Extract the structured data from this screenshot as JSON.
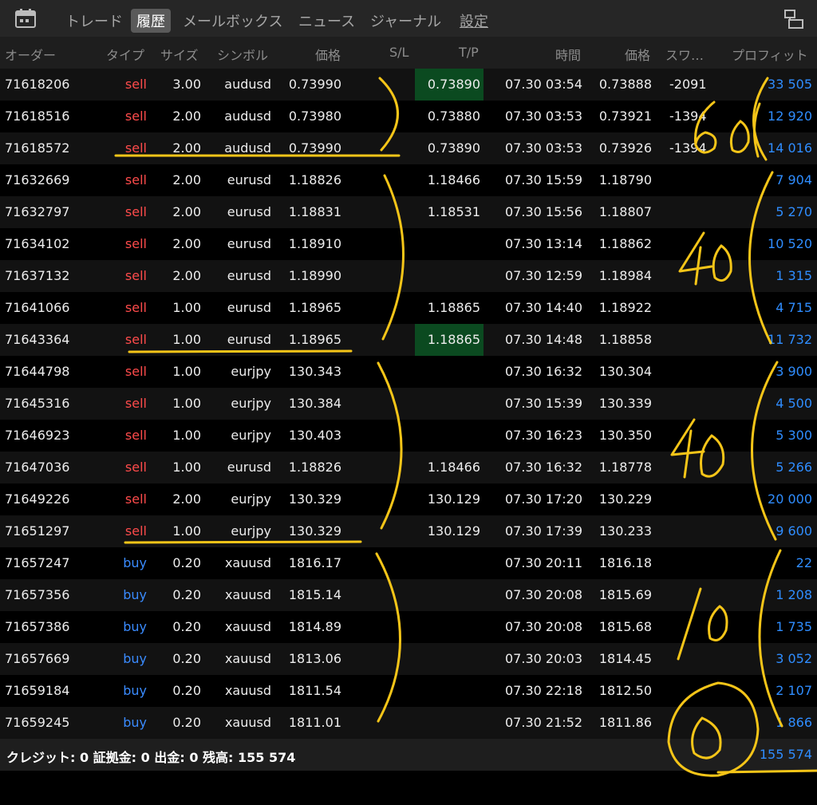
{
  "toolbar": {
    "app_icon": "calendar-icon",
    "tabs": [
      "トレード",
      "履歴",
      "メールボックス",
      "ニュース",
      "ジャーナル",
      "設定"
    ],
    "active_tab": "履歴",
    "right_icon": "split-view-icon"
  },
  "columns": [
    "オーダー",
    "タイプ",
    "サイズ",
    "シンボル",
    "価格",
    "S/L",
    "T/P",
    "時間",
    "価格",
    "スワ…",
    "プロフィット"
  ],
  "rows": [
    {
      "order": "71618206",
      "type": "sell",
      "size": "3.00",
      "symbol": "audusd",
      "price": "0.73990",
      "sl": "",
      "tp": "0.73890",
      "tp_hl": true,
      "time": "07.30 03:54",
      "close": "0.73888",
      "swap": "-2091",
      "profit": "33 505"
    },
    {
      "order": "71618516",
      "type": "sell",
      "size": "2.00",
      "symbol": "audusd",
      "price": "0.73980",
      "sl": "",
      "tp": "0.73880",
      "tp_hl": false,
      "time": "07.30 03:53",
      "close": "0.73921",
      "swap": "-1394",
      "profit": "12 920"
    },
    {
      "order": "71618572",
      "type": "sell",
      "size": "2.00",
      "symbol": "audusd",
      "price": "0.73990",
      "sl": "",
      "tp": "0.73890",
      "tp_hl": false,
      "time": "07.30 03:53",
      "close": "0.73926",
      "swap": "-1394",
      "profit": "14 016"
    },
    {
      "order": "71632669",
      "type": "sell",
      "size": "2.00",
      "symbol": "eurusd",
      "price": "1.18826",
      "sl": "",
      "tp": "1.18466",
      "tp_hl": false,
      "time": "07.30 15:59",
      "close": "1.18790",
      "swap": "",
      "profit": "7 904"
    },
    {
      "order": "71632797",
      "type": "sell",
      "size": "2.00",
      "symbol": "eurusd",
      "price": "1.18831",
      "sl": "",
      "tp": "1.18531",
      "tp_hl": false,
      "time": "07.30 15:56",
      "close": "1.18807",
      "swap": "",
      "profit": "5 270"
    },
    {
      "order": "71634102",
      "type": "sell",
      "size": "2.00",
      "symbol": "eurusd",
      "price": "1.18910",
      "sl": "",
      "tp": "",
      "tp_hl": false,
      "time": "07.30 13:14",
      "close": "1.18862",
      "swap": "",
      "profit": "10 520"
    },
    {
      "order": "71637132",
      "type": "sell",
      "size": "2.00",
      "symbol": "eurusd",
      "price": "1.18990",
      "sl": "",
      "tp": "",
      "tp_hl": false,
      "time": "07.30 12:59",
      "close": "1.18984",
      "swap": "",
      "profit": "1 315"
    },
    {
      "order": "71641066",
      "type": "sell",
      "size": "1.00",
      "symbol": "eurusd",
      "price": "1.18965",
      "sl": "",
      "tp": "1.18865",
      "tp_hl": false,
      "time": "07.30 14:40",
      "close": "1.18922",
      "swap": "",
      "profit": "4 715"
    },
    {
      "order": "71643364",
      "type": "sell",
      "size": "1.00",
      "symbol": "eurusd",
      "price": "1.18965",
      "sl": "",
      "tp": "1.18865",
      "tp_hl": true,
      "time": "07.30 14:48",
      "close": "1.18858",
      "swap": "",
      "profit": "11 732"
    },
    {
      "order": "71644798",
      "type": "sell",
      "size": "1.00",
      "symbol": "eurjpy",
      "price": "130.343",
      "sl": "",
      "tp": "",
      "tp_hl": false,
      "time": "07.30 16:32",
      "close": "130.304",
      "swap": "",
      "profit": "3 900"
    },
    {
      "order": "71645316",
      "type": "sell",
      "size": "1.00",
      "symbol": "eurjpy",
      "price": "130.384",
      "sl": "",
      "tp": "",
      "tp_hl": false,
      "time": "07.30 15:39",
      "close": "130.339",
      "swap": "",
      "profit": "4 500"
    },
    {
      "order": "71646923",
      "type": "sell",
      "size": "1.00",
      "symbol": "eurjpy",
      "price": "130.403",
      "sl": "",
      "tp": "",
      "tp_hl": false,
      "time": "07.30 16:23",
      "close": "130.350",
      "swap": "",
      "profit": "5 300"
    },
    {
      "order": "71647036",
      "type": "sell",
      "size": "1.00",
      "symbol": "eurusd",
      "price": "1.18826",
      "sl": "",
      "tp": "1.18466",
      "tp_hl": false,
      "time": "07.30 16:32",
      "close": "1.18778",
      "swap": "",
      "profit": "5 266"
    },
    {
      "order": "71649226",
      "type": "sell",
      "size": "2.00",
      "symbol": "eurjpy",
      "price": "130.329",
      "sl": "",
      "tp": "130.129",
      "tp_hl": false,
      "time": "07.30 17:20",
      "close": "130.229",
      "swap": "",
      "profit": "20 000"
    },
    {
      "order": "71651297",
      "type": "sell",
      "size": "1.00",
      "symbol": "eurjpy",
      "price": "130.329",
      "sl": "",
      "tp": "130.129",
      "tp_hl": false,
      "time": "07.30 17:39",
      "close": "130.233",
      "swap": "",
      "profit": "9 600"
    },
    {
      "order": "71657247",
      "type": "buy",
      "size": "0.20",
      "symbol": "xauusd",
      "price": "1816.17",
      "sl": "",
      "tp": "",
      "tp_hl": false,
      "time": "07.30 20:11",
      "close": "1816.18",
      "swap": "",
      "profit": "22"
    },
    {
      "order": "71657356",
      "type": "buy",
      "size": "0.20",
      "symbol": "xauusd",
      "price": "1815.14",
      "sl": "",
      "tp": "",
      "tp_hl": false,
      "time": "07.30 20:08",
      "close": "1815.69",
      "swap": "",
      "profit": "1 208"
    },
    {
      "order": "71657386",
      "type": "buy",
      "size": "0.20",
      "symbol": "xauusd",
      "price": "1814.89",
      "sl": "",
      "tp": "",
      "tp_hl": false,
      "time": "07.30 20:08",
      "close": "1815.68",
      "swap": "",
      "profit": "1 735"
    },
    {
      "order": "71657669",
      "type": "buy",
      "size": "0.20",
      "symbol": "xauusd",
      "price": "1813.06",
      "sl": "",
      "tp": "",
      "tp_hl": false,
      "time": "07.30 20:03",
      "close": "1814.45",
      "swap": "",
      "profit": "3 052"
    },
    {
      "order": "71659184",
      "type": "buy",
      "size": "0.20",
      "symbol": "xauusd",
      "price": "1811.54",
      "sl": "",
      "tp": "",
      "tp_hl": false,
      "time": "07.30 22:18",
      "close": "1812.50",
      "swap": "",
      "profit": "2 107"
    },
    {
      "order": "71659245",
      "type": "buy",
      "size": "0.20",
      "symbol": "xauusd",
      "price": "1811.01",
      "sl": "",
      "tp": "",
      "tp_hl": false,
      "time": "07.30 21:52",
      "close": "1811.86",
      "swap": "",
      "profit": "1 866"
    }
  ],
  "footer": {
    "summary": "クレジット: 0 証拠金: 0 出金: 0 残高: 155 574",
    "balance": "155 574"
  },
  "handwriting": {
    "color": "#f5c518",
    "notes": [
      "60",
      "40",
      "40",
      "10",
      "0"
    ]
  },
  "colors": {
    "sell": "#ff4b4b",
    "buy": "#3a8bff",
    "profit": "#2f8dff",
    "tp_highlight": "#0b4a20"
  }
}
